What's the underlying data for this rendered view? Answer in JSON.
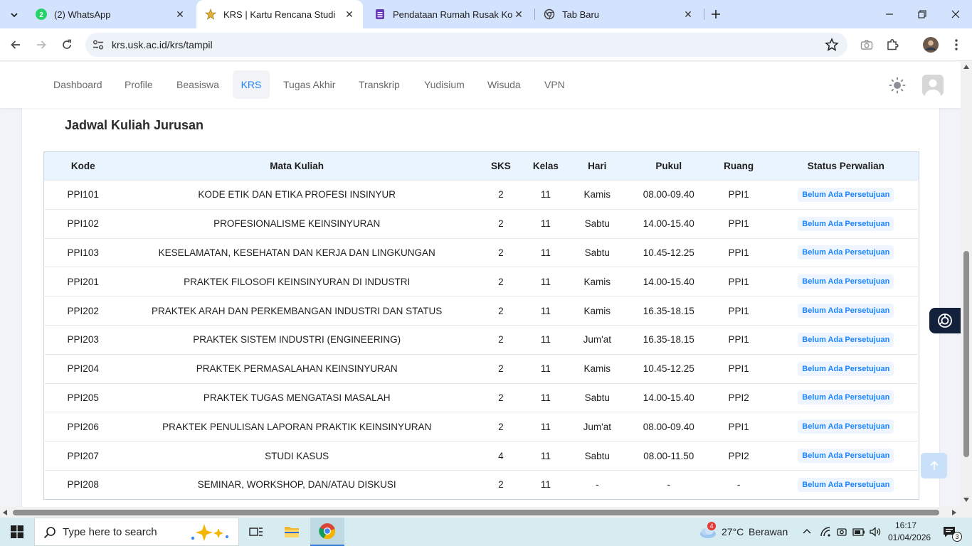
{
  "browser": {
    "tabs": [
      {
        "title": "(2) WhatsApp",
        "badge": "2",
        "icon": "whatsapp-icon",
        "active": false
      },
      {
        "title": "KRS | Kartu Rencana Studi",
        "icon": "usk-logo-icon",
        "active": true
      },
      {
        "title": "Pendataan Rumah Rusak Kota L",
        "icon": "forms-icon",
        "active": false
      },
      {
        "title": "Tab Baru",
        "icon": "chrome-newtab-icon",
        "active": false
      }
    ],
    "url": "krs.usk.ac.id/krs/tampil"
  },
  "nav": {
    "items": [
      {
        "label": "Dashboard",
        "active": false
      },
      {
        "label": "Profile",
        "active": false
      },
      {
        "label": "Beasiswa",
        "active": false
      },
      {
        "label": "KRS",
        "active": true
      },
      {
        "label": "Tugas Akhir",
        "active": false
      },
      {
        "label": "Transkrip",
        "active": false
      },
      {
        "label": "Yudisium",
        "active": false
      },
      {
        "label": "Wisuda",
        "active": false
      },
      {
        "label": "VPN",
        "active": false
      }
    ]
  },
  "schedule": {
    "title": "Jadwal Kuliah Jurusan",
    "headers": {
      "kode": "Kode",
      "mata_kuliah": "Mata Kuliah",
      "sks": "SKS",
      "kelas": "Kelas",
      "hari": "Hari",
      "pukul": "Pukul",
      "ruang": "Ruang",
      "status": "Status Perwalian"
    },
    "rows": [
      {
        "kode": "PPI101",
        "mata_kuliah": "KODE ETIK DAN ETIKA PROFESI INSINYUR",
        "sks": "2",
        "kelas": "11",
        "hari": "Kamis",
        "pukul": "08.00-09.40",
        "ruang": "PPI1",
        "status": "Belum Ada Persetujuan"
      },
      {
        "kode": "PPI102",
        "mata_kuliah": "PROFESIONALISME KEINSINYURAN",
        "sks": "2",
        "kelas": "11",
        "hari": "Sabtu",
        "pukul": "14.00-15.40",
        "ruang": "PPI1",
        "status": "Belum Ada Persetujuan"
      },
      {
        "kode": "PPI103",
        "mata_kuliah": "KESELAMATAN, KESEHATAN DAN KERJA DAN LINGKUNGAN",
        "sks": "2",
        "kelas": "11",
        "hari": "Sabtu",
        "pukul": "10.45-12.25",
        "ruang": "PPI1",
        "status": "Belum Ada Persetujuan"
      },
      {
        "kode": "PPI201",
        "mata_kuliah": "PRAKTEK FILOSOFI KEINSINYURAN DI INDUSTRI",
        "sks": "2",
        "kelas": "11",
        "hari": "Kamis",
        "pukul": "14.00-15.40",
        "ruang": "PPI1",
        "status": "Belum Ada Persetujuan"
      },
      {
        "kode": "PPI202",
        "mata_kuliah": "PRAKTEK ARAH DAN PERKEMBANGAN INDUSTRI DAN STATUS",
        "sks": "2",
        "kelas": "11",
        "hari": "Kamis",
        "pukul": "16.35-18.15",
        "ruang": "PPI1",
        "status": "Belum Ada Persetujuan"
      },
      {
        "kode": "PPI203",
        "mata_kuliah": "PRAKTEK SISTEM INDUSTRI (ENGINEERING)",
        "sks": "2",
        "kelas": "11",
        "hari": "Jum'at",
        "pukul": "16.35-18.15",
        "ruang": "PPI1",
        "status": "Belum Ada Persetujuan"
      },
      {
        "kode": "PPI204",
        "mata_kuliah": "PRAKTEK PERMASALAHAN KEINSINYURAN",
        "sks": "2",
        "kelas": "11",
        "hari": "Kamis",
        "pukul": "10.45-12.25",
        "ruang": "PPI1",
        "status": "Belum Ada Persetujuan"
      },
      {
        "kode": "PPI205",
        "mata_kuliah": "PRAKTEK TUGAS MENGATASI MASALAH",
        "sks": "2",
        "kelas": "11",
        "hari": "Sabtu",
        "pukul": "14.00-15.40",
        "ruang": "PPI2",
        "status": "Belum Ada Persetujuan"
      },
      {
        "kode": "PPI206",
        "mata_kuliah": "PRAKTEK PENULISAN LAPORAN PRAKTIK KEINSINYURAN",
        "sks": "2",
        "kelas": "11",
        "hari": "Jum'at",
        "pukul": "08.00-09.40",
        "ruang": "PPI1",
        "status": "Belum Ada Persetujuan"
      },
      {
        "kode": "PPI207",
        "mata_kuliah": "STUDI KASUS",
        "sks": "4",
        "kelas": "11",
        "hari": "Sabtu",
        "pukul": "08.00-11.50",
        "ruang": "PPI2",
        "status": "Belum Ada Persetujuan"
      },
      {
        "kode": "PPI208",
        "mata_kuliah": "SEMINAR, WORKSHOP, DAN/ATAU DISKUSI",
        "sks": "2",
        "kelas": "11",
        "hari": "-",
        "pukul": "-",
        "ruang": "-",
        "status": "Belum Ada Persetujuan"
      }
    ]
  },
  "taskbar": {
    "search_placeholder": "Type here to search",
    "weather": {
      "badge": "4",
      "temp": "27°C",
      "condition": "Berawan"
    },
    "time": "16:17",
    "date": "01/04/2026",
    "notification_count": "3"
  },
  "colors": {
    "accent": "#1b84ff",
    "header_bg": "#eaf4ff",
    "tabstrip": "#d3e3fd",
    "taskbar": "#d6ecf0"
  }
}
